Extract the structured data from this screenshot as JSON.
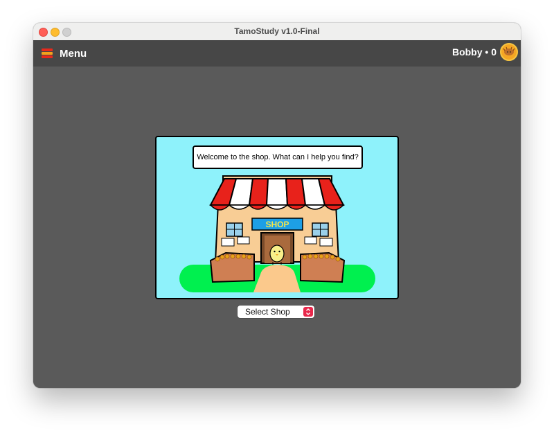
{
  "window": {
    "title": "TamoStudy v1.0-Final"
  },
  "appbar": {
    "menu_label": "Menu",
    "user_label": "Bobby • 0"
  },
  "shop": {
    "dialog": "Welcome to the shop. What can I help you find?",
    "sign": "SHOP",
    "select_label": "Select Shop"
  },
  "colors": {
    "sky": "#8ef2fb",
    "grass": "#00f04f",
    "awning_red": "#e8221b",
    "sign_blue": "#1d9fe6"
  }
}
